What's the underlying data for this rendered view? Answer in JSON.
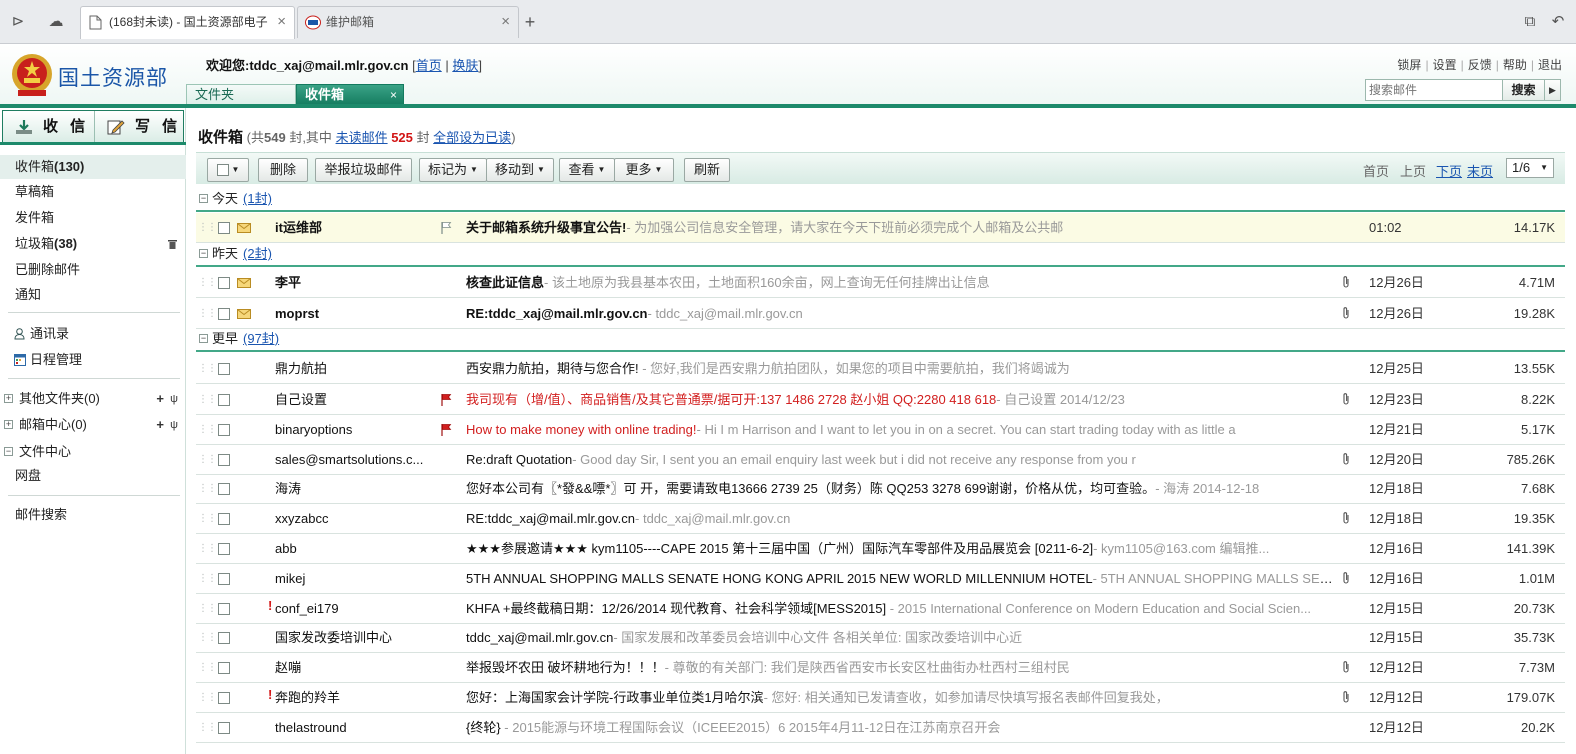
{
  "browser": {
    "tabs": [
      {
        "title": "(168封未读) - 国土资源部电子",
        "active": true
      },
      {
        "title": "维护邮箱",
        "active": false
      }
    ],
    "new_tab": "+"
  },
  "header": {
    "logo_text": "国土资源部",
    "welcome_prefix": "欢迎您:",
    "user_email": "tddc_xaj@mail.mlr.gov.cn",
    "home_link": "首页",
    "switch_link": "换肤",
    "top_links": [
      "锁屏",
      "设置",
      "反馈",
      "帮助",
      "退出"
    ],
    "search_placeholder": "搜索邮件",
    "search_button": "搜索",
    "tabs": {
      "folders": "文件夹",
      "inbox": "收件箱"
    }
  },
  "sidebar": {
    "receive": "收 信",
    "write": "写 信",
    "folders": [
      {
        "label": "收件箱",
        "count": "(130)"
      },
      {
        "label": "草稿箱",
        "count": ""
      },
      {
        "label": "发件箱",
        "count": ""
      },
      {
        "label": "垃圾箱",
        "count": "(38)"
      },
      {
        "label": "已删除邮件",
        "count": ""
      },
      {
        "label": "通知",
        "count": ""
      }
    ],
    "contacts": "通讯录",
    "calendar": "日程管理",
    "other_folders": "其他文件夹(0)",
    "mail_center": "邮箱中心(0)",
    "file_center": "文件中心",
    "netdisk": "网盘",
    "mail_search": "邮件搜索"
  },
  "main": {
    "title": "收件箱",
    "summary_a": "(共",
    "total": "549",
    "summary_b": "封,其中",
    "unread_link": "未读邮件",
    "unread_count": "525",
    "summary_c": "封",
    "mark_all_read": "全部设为已读",
    "summary_d": ")",
    "toolbar": {
      "delete": "删除",
      "report_spam": "举报垃圾邮件",
      "mark_as": "标记为",
      "move_to": "移动到",
      "view": "查看",
      "more": "更多",
      "refresh": "刷新"
    },
    "pager": {
      "first": "首页",
      "prev": "上页",
      "next": "下页",
      "last": "末页",
      "current": "1/6"
    },
    "groups": [
      {
        "label": "今天",
        "count": "(1封)"
      },
      {
        "label": "昨天",
        "count": "(2封)"
      },
      {
        "label": "更早",
        "count": "(97封)"
      }
    ],
    "emails": [
      {
        "from": "it运维部",
        "subject": "关于邮箱系统升级事宜公告!",
        "preview": "- 为加强公司信息安全管理，请大家在今天下班前必须完成个人邮箱及公共邮",
        "date": "01:02",
        "size": "14.17K"
      },
      {
        "from": "李平",
        "subject": "核查此证信息",
        "preview": "- 该土地原为我县基本农田，土地面积160余亩，网上查询无任何挂牌出让信息",
        "date": "12月26日",
        "size": "4.71M"
      },
      {
        "from": "moprst",
        "subject": "RE:tddc_xaj@mail.mlr.gov.cn",
        "preview": "- tddc_xaj@mail.mlr.gov.cn",
        "date": "12月26日",
        "size": "19.28K"
      },
      {
        "from": "鼎力航拍",
        "subject": "西安鼎力航拍，期待与您合作!",
        "preview": " -    您好,我们是西安鼎力航拍团队，如果您的项目中需要航拍，我们将竭诚为",
        "date": "12月25日",
        "size": "13.55K"
      },
      {
        "from": "自己设置",
        "subject": "我司现有（增/值）、商品销售/及其它普通票/据可开:137 1486 2728 赵小姐 QQ:2280 418 618",
        "preview": "- 自己设置 2014/12/23",
        "date": "12月23日",
        "size": "8.22K"
      },
      {
        "from": "binaryoptions",
        "subject": "How to make money with online trading!",
        "preview": "- Hi I m Harrison and I want to let you in on a secret.  You can start trading today with as little a",
        "date": "12月21日",
        "size": "5.17K"
      },
      {
        "from": "sales@smartsolutions.c...",
        "subject": "Re:draft Quotation",
        "preview": "-    Good day Sir, I sent you an email enquiry last week but i did not receive any response from you r",
        "date": "12月20日",
        "size": "785.26K"
      },
      {
        "from": "海涛",
        "subject": "您好本公司有〖*發&&嘌*〗可 开，需要请致电13666 2739 25（财务）陈 QQ253 3278 699谢谢，价格从优，均可查验。",
        "preview": "- 海涛 2014-12-18",
        "date": "12月18日",
        "size": "7.68K"
      },
      {
        "from": "xxyzabcc",
        "subject": "RE:tddc_xaj@mail.mlr.gov.cn",
        "preview": "- tddc_xaj@mail.mlr.gov.cn",
        "date": "12月18日",
        "size": "19.35K"
      },
      {
        "from": "abb",
        "subject": "★★★参展邀请★★★ kym1105----CAPE 2015 第十三届中国（广州）国际汽车零部件及用品展览会 [0211-6-2]",
        "preview": "- kym1105@163.com            编辑推...",
        "date": "12月16日",
        "size": "141.39K"
      },
      {
        "from": "mikej",
        "subject": "5TH ANNUAL SHOPPING MALLS SENATE HONG KONG APRIL 2015 NEW WORLD  MILLENNIUM HOTEL",
        "preview": "-  5TH ANNUAL SHOPPING MALLS SENA...",
        "date": "12月16日",
        "size": "1.01M"
      },
      {
        "from": "conf_ei179",
        "subject": "KHFA +最终截稿日期：12/26/2014 现代教育、社会科学领域[MESS2015]",
        "preview": " - 2015 International Conference on Modern Education and Social Scien...",
        "date": "12月15日",
        "size": "20.73K"
      },
      {
        "from": "国家发改委培训中心",
        "subject": "tddc_xaj@mail.mlr.gov.cn",
        "preview": "- 国家发展和改革委员会培训中心文件 各相关单位:      国家改委培训中心近",
        "date": "12月15日",
        "size": "35.73K"
      },
      {
        "from": "赵嘣",
        "subject": "举报毁坏农田  破坏耕地行为！！！",
        "preview": "- 尊敬的有关部门:      我们是陕西省西安市长安区杜曲街办杜西村三组村民",
        "date": "12月12日",
        "size": "7.73M"
      },
      {
        "from": "奔跑的羚羊",
        "subject": "您好：上海国家会计学院-行政事业单位类1月哈尔滨",
        "preview": "- 您好:       相关通知已发请查收，如参加请尽快填写报名表邮件回复我处，",
        "date": "12月12日",
        "size": "179.07K"
      },
      {
        "from": "thelastround",
        "subject": "{终轮}",
        "preview": " - 2015能源与环境工程国际会议（ICEEE2015）6 2015年4月11-12日在江苏南京召开会",
        "date": "12月12日",
        "size": "20.2K"
      }
    ]
  }
}
